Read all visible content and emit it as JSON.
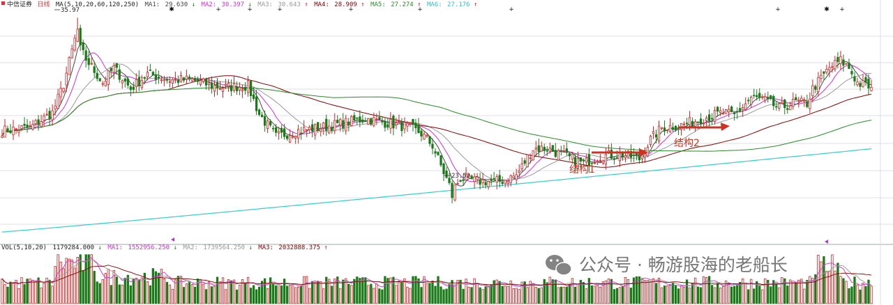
{
  "colors": {
    "up": "#cc2222",
    "down": "#1a7a1a",
    "ma1": "#444444",
    "ma2": "#cc33cc",
    "ma3": "#999999",
    "ma4": "#800000",
    "ma5": "#2a8a2a",
    "ma6": "#33cccc",
    "arrow": "#cc3322",
    "grid": "#cfd4dc"
  },
  "price_panel": {
    "stock_name": "中信证券",
    "period": "日线",
    "ma_label": "MA(5,10,20,60,120,250)",
    "indicators": [
      {
        "name": "MA1:",
        "value": "29.630",
        "trend": "↓"
      },
      {
        "name": "MA2:",
        "value": "30.397",
        "trend": "↓"
      },
      {
        "name": "MA3:",
        "value": "30.643",
        "trend": "↑"
      },
      {
        "name": "MA4:",
        "value": "28.909",
        "trend": "↑"
      },
      {
        "name": "MA5:",
        "value": "27.274",
        "trend": "↑"
      },
      {
        "name": "MA6:",
        "value": "27.176",
        "trend": "↑"
      }
    ],
    "high_label": "35.97",
    "low_label": "23.52"
  },
  "annotations": {
    "struct1": "结构1",
    "struct2": "结构2"
  },
  "volume_panel": {
    "label": "VOL(5,10,20)",
    "indicators": [
      {
        "name": "",
        "value": "1179284.000",
        "trend": "↓"
      },
      {
        "name": "MA1:",
        "value": "1552956.250",
        "trend": "↓"
      },
      {
        "name": "MA2:",
        "value": "1739564.250",
        "trend": "↓"
      },
      {
        "name": "MA3:",
        "value": "2032888.375",
        "trend": "↑"
      }
    ]
  },
  "watermark": "公众号 · 畅游股海的老船长",
  "chart_data": {
    "type": "candlestick",
    "title": "中信证券 日线",
    "price_range": [
      21.0,
      36.5
    ],
    "price_high": 35.97,
    "price_low": 23.52,
    "close_anchors": [
      [
        0,
        28.4
      ],
      [
        10,
        28.6
      ],
      [
        18,
        29.6
      ],
      [
        22,
        31.5
      ],
      [
        26,
        34.5
      ],
      [
        30,
        33.2
      ],
      [
        36,
        31.6
      ],
      [
        40,
        32.6
      ],
      [
        46,
        31.2
      ],
      [
        52,
        32.2
      ],
      [
        60,
        31.8
      ],
      [
        68,
        31.8
      ],
      [
        75,
        31.4
      ],
      [
        80,
        31.3
      ],
      [
        88,
        31.4
      ],
      [
        92,
        29.5
      ],
      [
        98,
        28.0
      ],
      [
        106,
        28.4
      ],
      [
        114,
        28.6
      ],
      [
        122,
        28.9
      ],
      [
        130,
        29.2
      ],
      [
        138,
        28.9
      ],
      [
        146,
        28.6
      ],
      [
        150,
        28.2
      ],
      [
        154,
        27.4
      ],
      [
        158,
        25.6
      ],
      [
        161,
        24.3
      ],
      [
        164,
        25.2
      ],
      [
        170,
        25.0
      ],
      [
        178,
        25.0
      ],
      [
        184,
        25.4
      ],
      [
        190,
        27.2
      ],
      [
        195,
        27.2
      ],
      [
        200,
        26.8
      ],
      [
        208,
        26.2
      ],
      [
        214,
        26.7
      ],
      [
        222,
        26.8
      ],
      [
        228,
        26.5
      ],
      [
        232,
        27.8
      ],
      [
        236,
        28.6
      ],
      [
        244,
        28.8
      ],
      [
        252,
        29.3
      ],
      [
        258,
        29.6
      ],
      [
        262,
        29.4
      ],
      [
        268,
        30.6
      ],
      [
        272,
        30.5
      ],
      [
        278,
        29.9
      ],
      [
        284,
        30.3
      ],
      [
        288,
        30.2
      ],
      [
        290,
        31.2
      ],
      [
        296,
        32.6
      ],
      [
        300,
        33.1
      ],
      [
        303,
        32.6
      ],
      [
        306,
        31.6
      ],
      [
        311,
        31.3
      ]
    ],
    "ma_periods": [
      5,
      10,
      20,
      60,
      120,
      250
    ],
    "volume_range": [
      0,
      6000000
    ],
    "arrows": [
      "结构1",
      "结构2"
    ]
  }
}
